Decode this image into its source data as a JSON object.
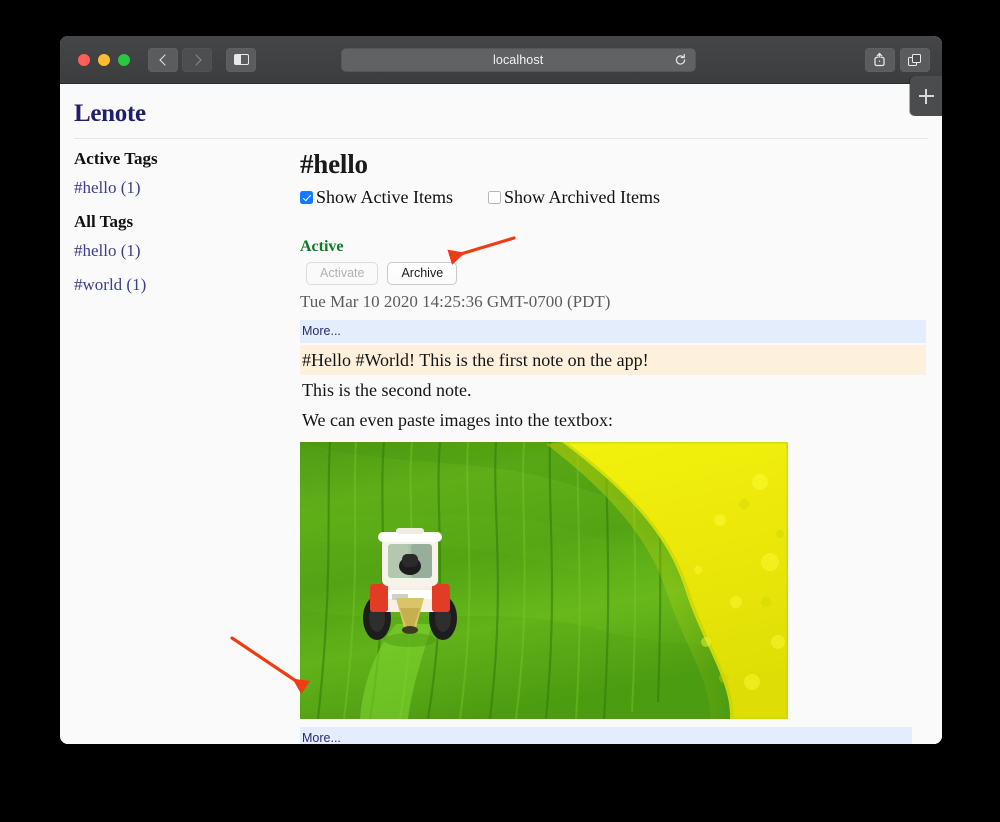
{
  "browser": {
    "address": "localhost",
    "icons": {
      "back": "back-chevron-icon",
      "forward": "forward-chevron-icon",
      "sidebar": "sidebar-toggle-icon",
      "reload": "reload-icon",
      "share": "share-icon",
      "tabs": "tab-overview-icon",
      "new_tab": "new-tab-plus-icon"
    },
    "traffic_lights": {
      "close": "#ff5f57",
      "minimize": "#febc2e",
      "maximize": "#28c840"
    }
  },
  "app": {
    "title": "Lenote",
    "title_color": "#1f1f6e"
  },
  "sidebar": {
    "sections": [
      {
        "heading": "Active Tags",
        "tags": [
          {
            "name": "#hello",
            "count": "(1)"
          }
        ]
      },
      {
        "heading": "All Tags",
        "tags": [
          {
            "name": "#hello",
            "count": "(1)"
          },
          {
            "name": "#world",
            "count": "(1)"
          }
        ]
      }
    ],
    "link_color": "#3b3f8c"
  },
  "main": {
    "tag_title": "#hello",
    "filters": [
      {
        "label": "Show Active Items",
        "checked": true
      },
      {
        "label": "Show Archived Items",
        "checked": false
      }
    ],
    "note": {
      "status": "Active",
      "status_color": "#0a7a28",
      "buttons": [
        {
          "label": "Activate",
          "disabled": true
        },
        {
          "label": "Archive",
          "disabled": false
        }
      ],
      "timestamp": "Tue Mar 10 2020 14:25:36 GMT-0700 (PDT)",
      "more_top": "More...",
      "more_bottom": "More...",
      "lines": [
        {
          "text": "#Hello #World! This is the first note on the app!",
          "highlight": true
        },
        {
          "text": "This is the second note.",
          "highlight": false
        },
        {
          "text": "We can even paste images into the textbox:",
          "highlight": false
        }
      ],
      "image_alt": "aerial photo of tractor spreading in a green field beside a yellow rapeseed field",
      "highlight_color": "#fdf0dc",
      "more_band_color": "#e4edfb"
    }
  },
  "annotations": {
    "arrow_color": "#f03c14",
    "arrows": [
      {
        "name": "arrow-to-archive-button",
        "points_at": "Archive"
      },
      {
        "name": "arrow-to-bottom-more-link",
        "points_at": "More..."
      }
    ]
  }
}
